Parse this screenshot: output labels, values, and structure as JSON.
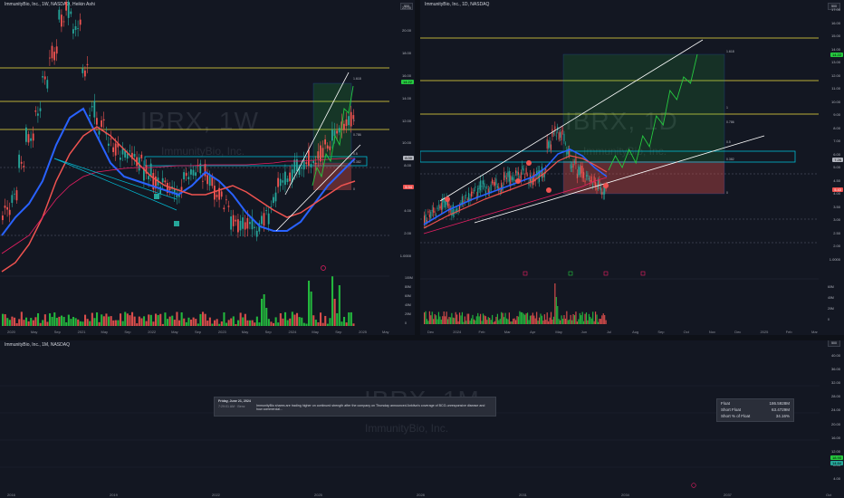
{
  "colors": {
    "bg": "#131722",
    "bull": "#26a69a",
    "bear": "#ef5350",
    "yellow": "#f0e040",
    "green": "#26c940",
    "blue": "#2962ff",
    "pink": "#e91e63",
    "cyan": "#00bcd4",
    "white": "#ffffff"
  },
  "pane_left": {
    "header": "ImmunityBio, Inc., 1W, NASDAQ, Heikin Ashi",
    "watermark_symbol": "IBRX, 1W",
    "watermark_name": "ImmunityBio, Inc.",
    "scale_button": "500",
    "price_axis": [
      "22.00",
      "20.00",
      "18.00",
      "16.00",
      "14.00",
      "12.00",
      "10.00",
      "8.00",
      "6.00",
      "4.00",
      "2.00",
      "1.0000"
    ],
    "fib_labels": [
      "1.618",
      "1",
      "0.786",
      "0.5",
      "0.382",
      "0"
    ],
    "tags": {
      "t1": "14.22",
      "t2": "8.00",
      "t3": "5.94",
      "t4": "5.59"
    },
    "x_labels": [
      "2020",
      "May",
      "Sep",
      "2021",
      "May",
      "Sep",
      "2022",
      "May",
      "Sep",
      "2023",
      "May",
      "Sep",
      "2024",
      "May",
      "Sep",
      "2025",
      "May"
    ],
    "vol_axis": [
      "100M",
      "80M",
      "60M",
      "40M",
      "20M",
      "0"
    ]
  },
  "pane_right": {
    "header": "ImmunityBio, Inc., 1D, NASDAQ",
    "watermark_symbol": "IBRX, 1D",
    "watermark_name": "ImmunityBio, Inc.",
    "scale_button": "500",
    "price_axis": [
      "17.00",
      "16.00",
      "15.00",
      "14.00",
      "13.00",
      "12.00",
      "11.00",
      "10.00",
      "9.00",
      "8.00",
      "7.00",
      "6.00",
      "5.00",
      "4.50",
      "4.00",
      "3.50",
      "3.00",
      "2.50",
      "2.00",
      "1.0000"
    ],
    "fib_labels": [
      "1.618",
      "1",
      "0.786",
      "0.5",
      "0.382",
      "0"
    ],
    "tags": {
      "t1": "14.22",
      "t2": "7.26",
      "t3": "5.43"
    },
    "x_labels": [
      "Dec",
      "2024",
      "Feb",
      "Mar",
      "Apr",
      "May",
      "Jun",
      "Jul",
      "Aug",
      "Sep",
      "Oct",
      "Nov",
      "Dec",
      "2025",
      "Feb",
      "Mar"
    ],
    "vol_axis": [
      "60M",
      "40M",
      "20M",
      "0"
    ]
  },
  "pane_bottom": {
    "header": "ImmunityBio, Inc., 1M, NASDAQ",
    "watermark_symbol": "IBRX, 1M",
    "watermark_name": "ImmunityBio, Inc.",
    "scale_button": "500",
    "price_axis": [
      "40.00",
      "36.00",
      "32.00",
      "28.00",
      "24.00",
      "20.00",
      "16.00",
      "12.00",
      "8.00",
      "4.00"
    ],
    "x_labels": [
      "2016",
      "2019",
      "2022",
      "2025",
      "2028",
      "2031",
      "2034",
      "2037",
      "Oct"
    ],
    "price_tag_a": "18.90",
    "price_tag_b": "14.84",
    "news": {
      "title": "Friday, June 21, 2024",
      "source": "7:29:01 AM · Benz",
      "body": "ImmunityBio shares are trading higher on continued strength after the company on Thursday announced Anktiva's coverage of BCG-unresponsive disease and how commercial..."
    },
    "float_box": {
      "rows": [
        {
          "label": "Float",
          "value": "186.5928M"
        },
        {
          "label": "Short Float",
          "value": "63.4729M"
        },
        {
          "label": "Short % of Float",
          "value": "34.16%"
        }
      ]
    }
  }
}
